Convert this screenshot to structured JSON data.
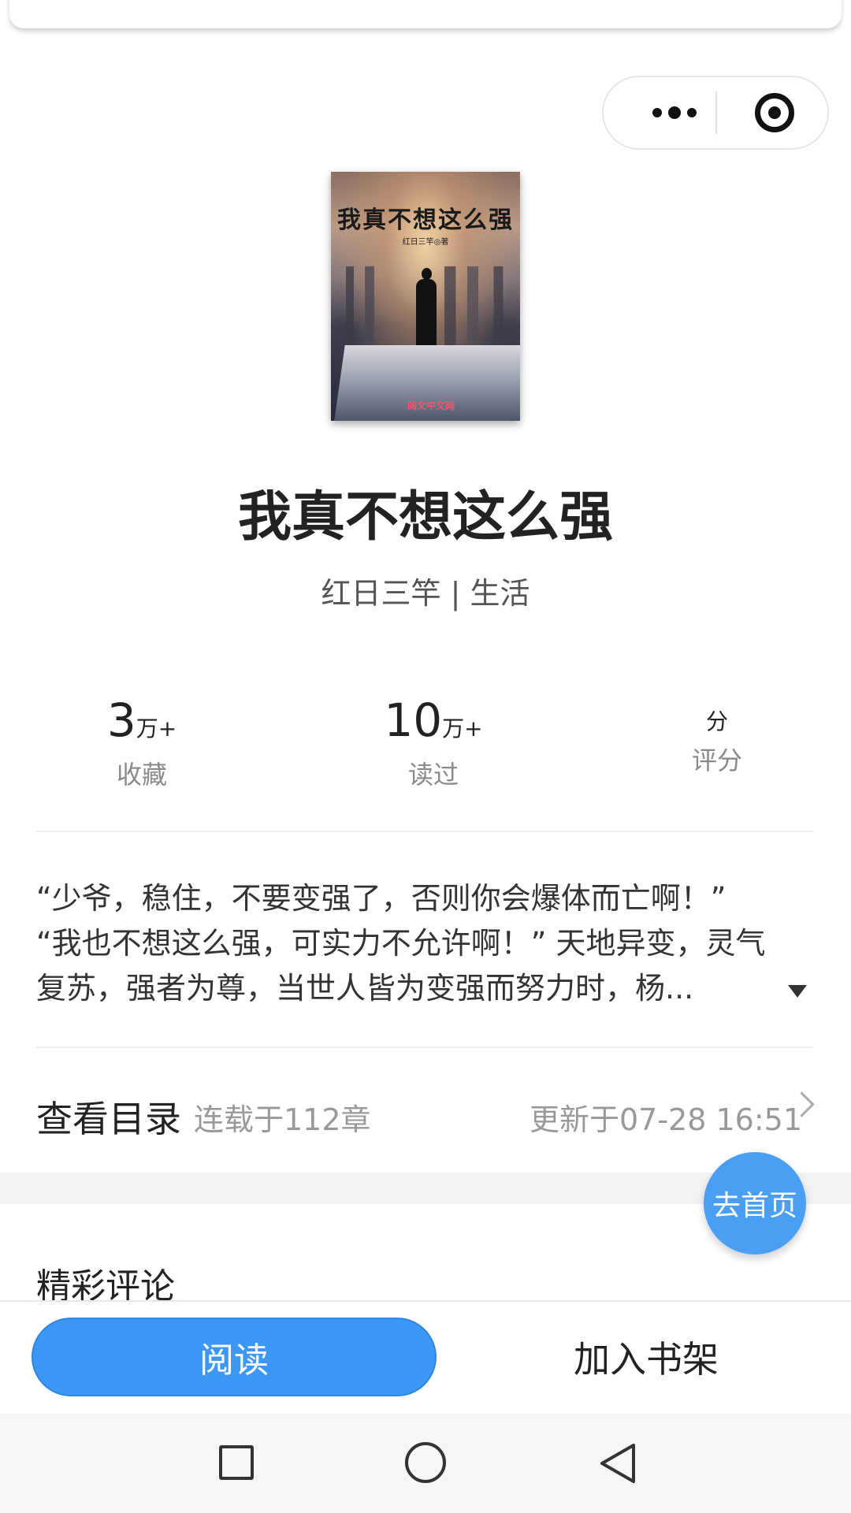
{
  "header": {
    "capsule": {
      "more_icon": "more-dots-icon",
      "close_icon": "target-circle-icon"
    }
  },
  "book": {
    "cover": {
      "title": "我真不想这么强",
      "author_line": "红日三竿◎著",
      "publisher_mark": "阅文中文网"
    },
    "title": "我真不想这么强",
    "meta": "红日三竿 | 生活"
  },
  "stats": [
    {
      "value": "3",
      "unit": "万+",
      "label": "收藏"
    },
    {
      "value": "10",
      "unit": "万+",
      "label": "读过"
    },
    {
      "value": "",
      "unit": "分",
      "label": "评分"
    }
  ],
  "description": {
    "lines": [
      "“少爷，稳住，不要变强了，否则你会爆体而亡啊！”",
      "“我也不想这么强，可实力不允许啊！” 天地异变，灵气",
      "复苏，强者为尊，当世人皆为变强而努力时，杨..."
    ],
    "expand_icon": "triangle-down-icon"
  },
  "catalog": {
    "title": "查看目录",
    "status": "连载于112章",
    "updated": "更新于07-28 16:51"
  },
  "comments": {
    "title": "精彩评论"
  },
  "fab": {
    "label": "去首页"
  },
  "actions": {
    "read": "阅读",
    "add_shelf": "加入书架"
  },
  "colors": {
    "primary": "#3d97f5",
    "fab": "#4a9ff4",
    "muted_text": "#999999"
  }
}
